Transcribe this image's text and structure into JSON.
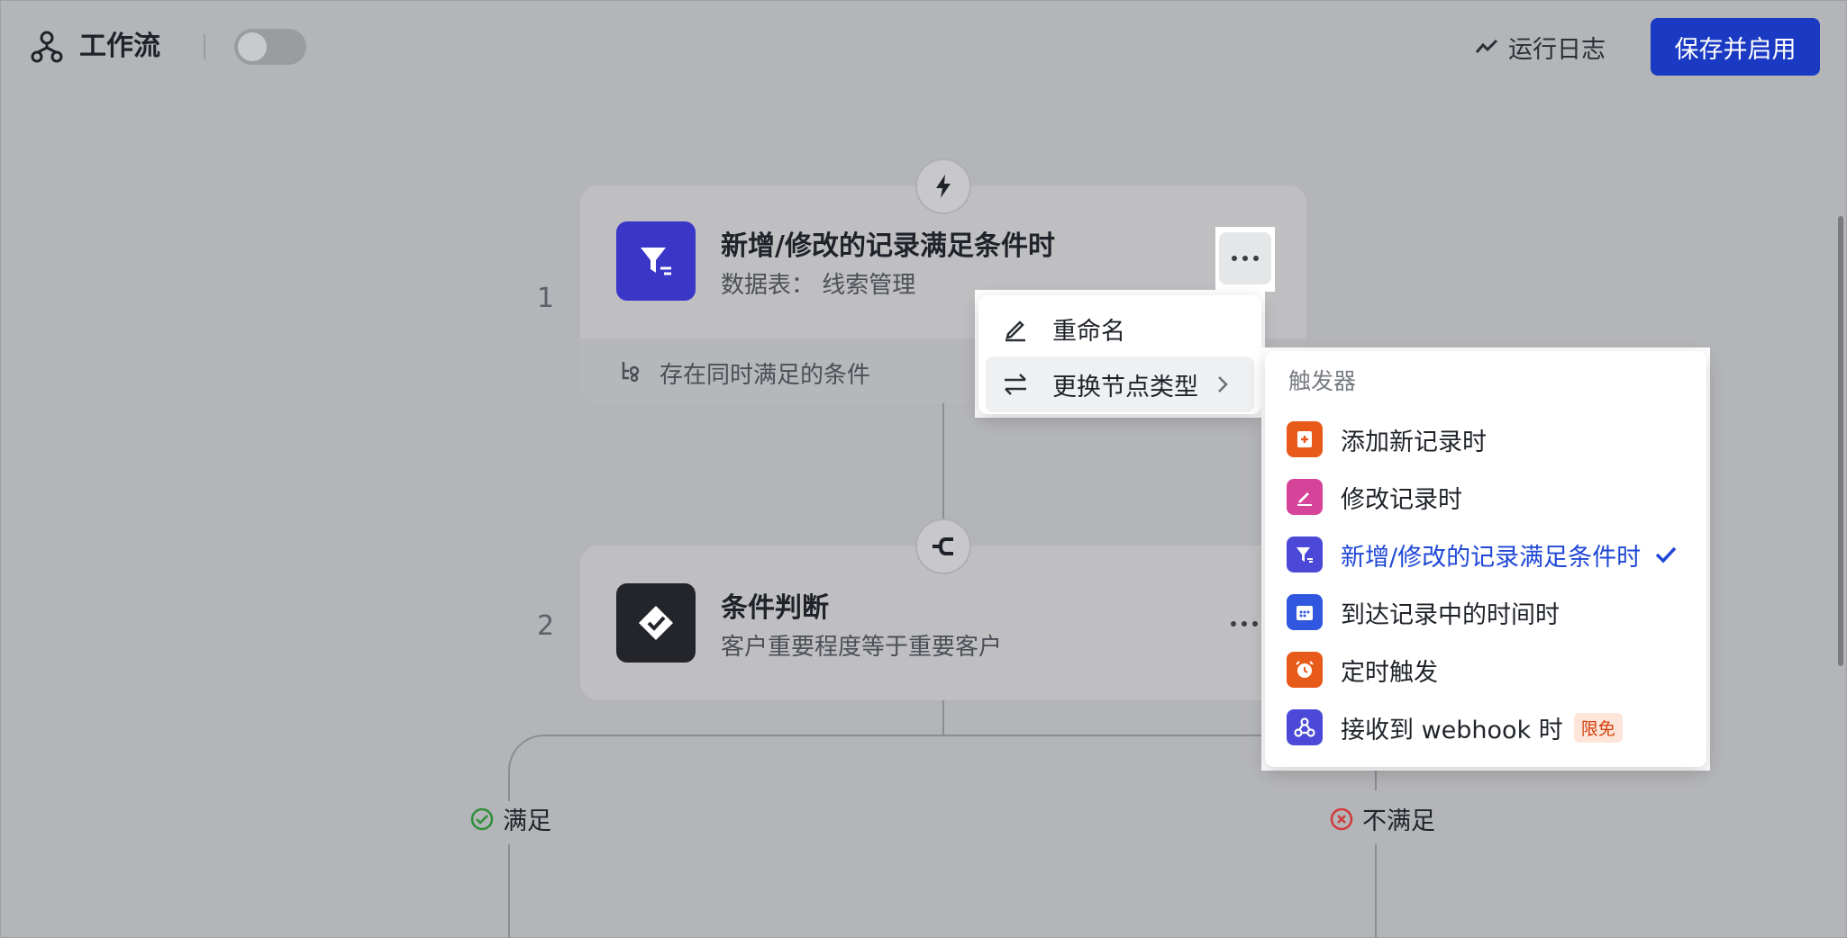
{
  "header": {
    "title": "工作流",
    "run_log_label": "运行日志",
    "save_label": "保存并启用"
  },
  "nodes": [
    {
      "index": "1",
      "title": "新增/修改的记录满足条件时",
      "subtitle": "数据表：  线索管理",
      "footer": "存在同时满足的条件"
    },
    {
      "index": "2",
      "title": "条件判断",
      "subtitle": "客户重要程度等于重要客户"
    }
  ],
  "branches": {
    "yes": "满足",
    "no": "不满足"
  },
  "context_menu": {
    "rename": "重命名",
    "change_type": "更换节点类型"
  },
  "submenu": {
    "heading": "触发器",
    "items": [
      {
        "label": "添加新记录时",
        "icon": "add-record-icon",
        "color": "#e85a1a"
      },
      {
        "label": "修改记录时",
        "icon": "edit-record-icon",
        "color": "#d6449a"
      },
      {
        "label": "新增/修改的记录满足条件时",
        "icon": "filter-icon",
        "color": "#4c49d8",
        "selected": true
      },
      {
        "label": "到达记录中的时间时",
        "icon": "calendar-icon",
        "color": "#3156e0"
      },
      {
        "label": "定时触发",
        "icon": "alarm-icon",
        "color": "#e85a1a"
      },
      {
        "label": "接收到 webhook 时",
        "icon": "webhook-icon",
        "color": "#4c49d8",
        "tag": "限免"
      }
    ]
  },
  "colors": {
    "primary": "#1b3ac3",
    "selected_text": "#1f48d6",
    "trigger_icon_bg": "#3a36c8",
    "condition_icon_bg": "#23252a",
    "yes_green": "#2e8f3a",
    "no_red": "#d23a3a"
  }
}
